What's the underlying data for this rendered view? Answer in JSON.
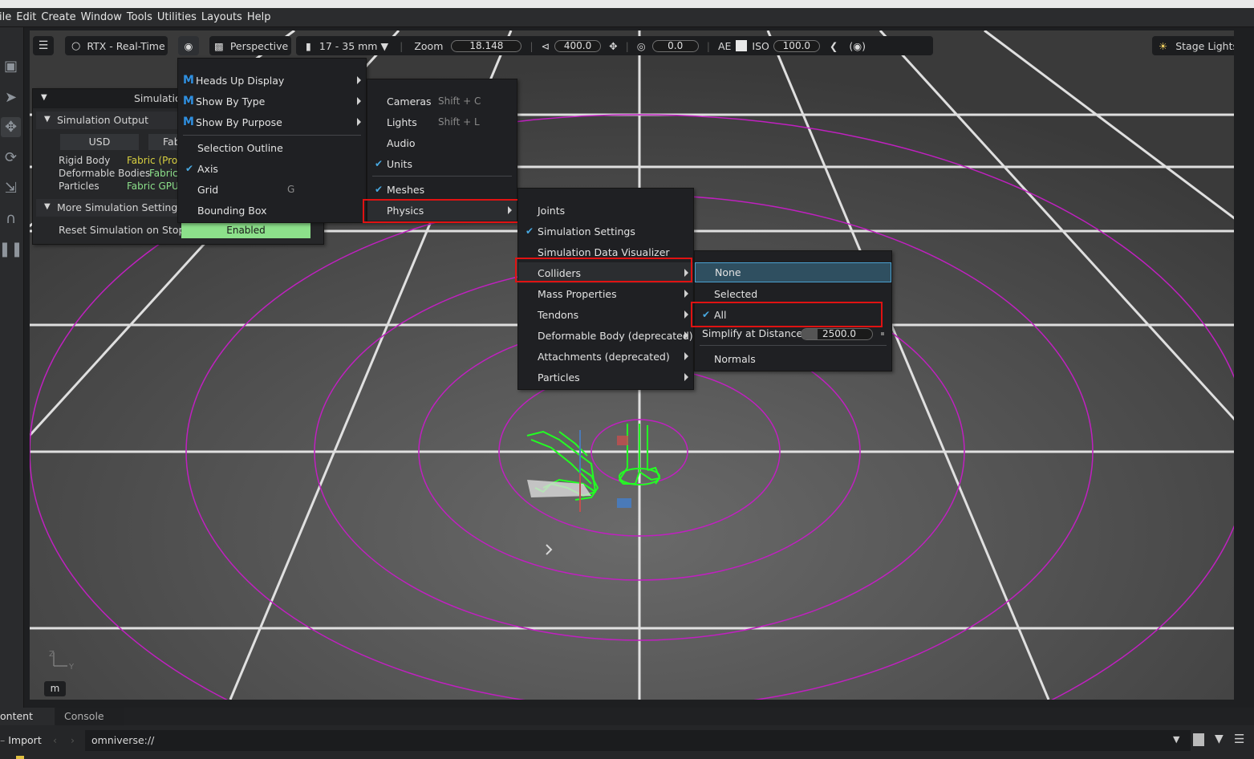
{
  "menubar": {
    "items": [
      "ile",
      "Edit",
      "Create",
      "Window",
      "Tools",
      "Utilities",
      "Layouts",
      "Help"
    ]
  },
  "viewport_toolbar": {
    "renderer": "RTX - Real-Time",
    "camera": "Perspective",
    "lens": "17 - 35 mm",
    "zoom_label": "Zoom",
    "zoom_value": "18.148",
    "fov_value": "400.0",
    "rot_value": "0.0",
    "ae_label": "AE",
    "iso_label": "ISO",
    "iso_value": "100.0",
    "stage_lights": "Stage Lights"
  },
  "sim_panel": {
    "title": "Simulatio",
    "section_output": "Simulation Output",
    "col_usd": "USD",
    "col_fabric": "Fab",
    "rows": [
      {
        "label": "Rigid Body",
        "value": "Fabric (Prop"
      },
      {
        "label": "Deformable Bodies",
        "value": "Fabric"
      },
      {
        "label": "Particles",
        "value": "Fabric GPU"
      }
    ],
    "section_more": "More Simulation Settings",
    "reset_label": "Reset Simulation on Stop",
    "reset_value": "Enabled"
  },
  "menu_show": {
    "items": [
      {
        "label": "Heads Up Display",
        "icon": "omniverse-m-icon",
        "submenu": true
      },
      {
        "label": "Show By Type",
        "icon": "omniverse-m-icon",
        "submenu": true
      },
      {
        "label": "Show By Purpose",
        "icon": "omniverse-m-icon",
        "submenu": true
      },
      {
        "label": "Selection Outline"
      },
      {
        "label": "Axis",
        "checked": true
      },
      {
        "label": "Grid",
        "shortcut": "G"
      },
      {
        "label": "Bounding Box"
      }
    ]
  },
  "menu_type": {
    "items": [
      {
        "label": "Cameras",
        "shortcut": "Shift + C"
      },
      {
        "label": "Lights",
        "shortcut": "Shift + L"
      },
      {
        "label": "Audio"
      },
      {
        "label": "Units",
        "checked": true
      },
      {
        "label": "Meshes",
        "checked": true
      },
      {
        "label": "Physics",
        "submenu": true,
        "highlighted": true
      }
    ]
  },
  "menu_physics": {
    "items": [
      {
        "label": "Joints"
      },
      {
        "label": "Simulation Settings",
        "checked": true
      },
      {
        "label": "Simulation Data Visualizer"
      },
      {
        "label": "Colliders",
        "submenu": true,
        "highlighted": true
      },
      {
        "label": "Mass Properties",
        "submenu": true
      },
      {
        "label": "Tendons",
        "submenu": true
      },
      {
        "label": "Deformable Body (deprecated)",
        "submenu": true
      },
      {
        "label": "Attachments (deprecated)",
        "submenu": true
      },
      {
        "label": "Particles",
        "submenu": true
      }
    ]
  },
  "menu_colliders": {
    "none": "None",
    "selected": "Selected",
    "all": "All",
    "simplify_label": "Simplify at Distance",
    "simplify_value": "2500.0",
    "normals": "Normals"
  },
  "axis_gizmo": {
    "z": "Z",
    "y": "Y"
  },
  "viewport_badge": "m",
  "bottom_tabs": [
    "ontent",
    "Console"
  ],
  "bottom_bar": {
    "import": "Import",
    "path": "omniverse://"
  },
  "colors": {
    "accent": "#48a8e0",
    "red_highlight": "#e01212",
    "enabled_green": "#8ce08a",
    "collider_green": "#22ff22",
    "ring_magenta": "#c020c0"
  }
}
